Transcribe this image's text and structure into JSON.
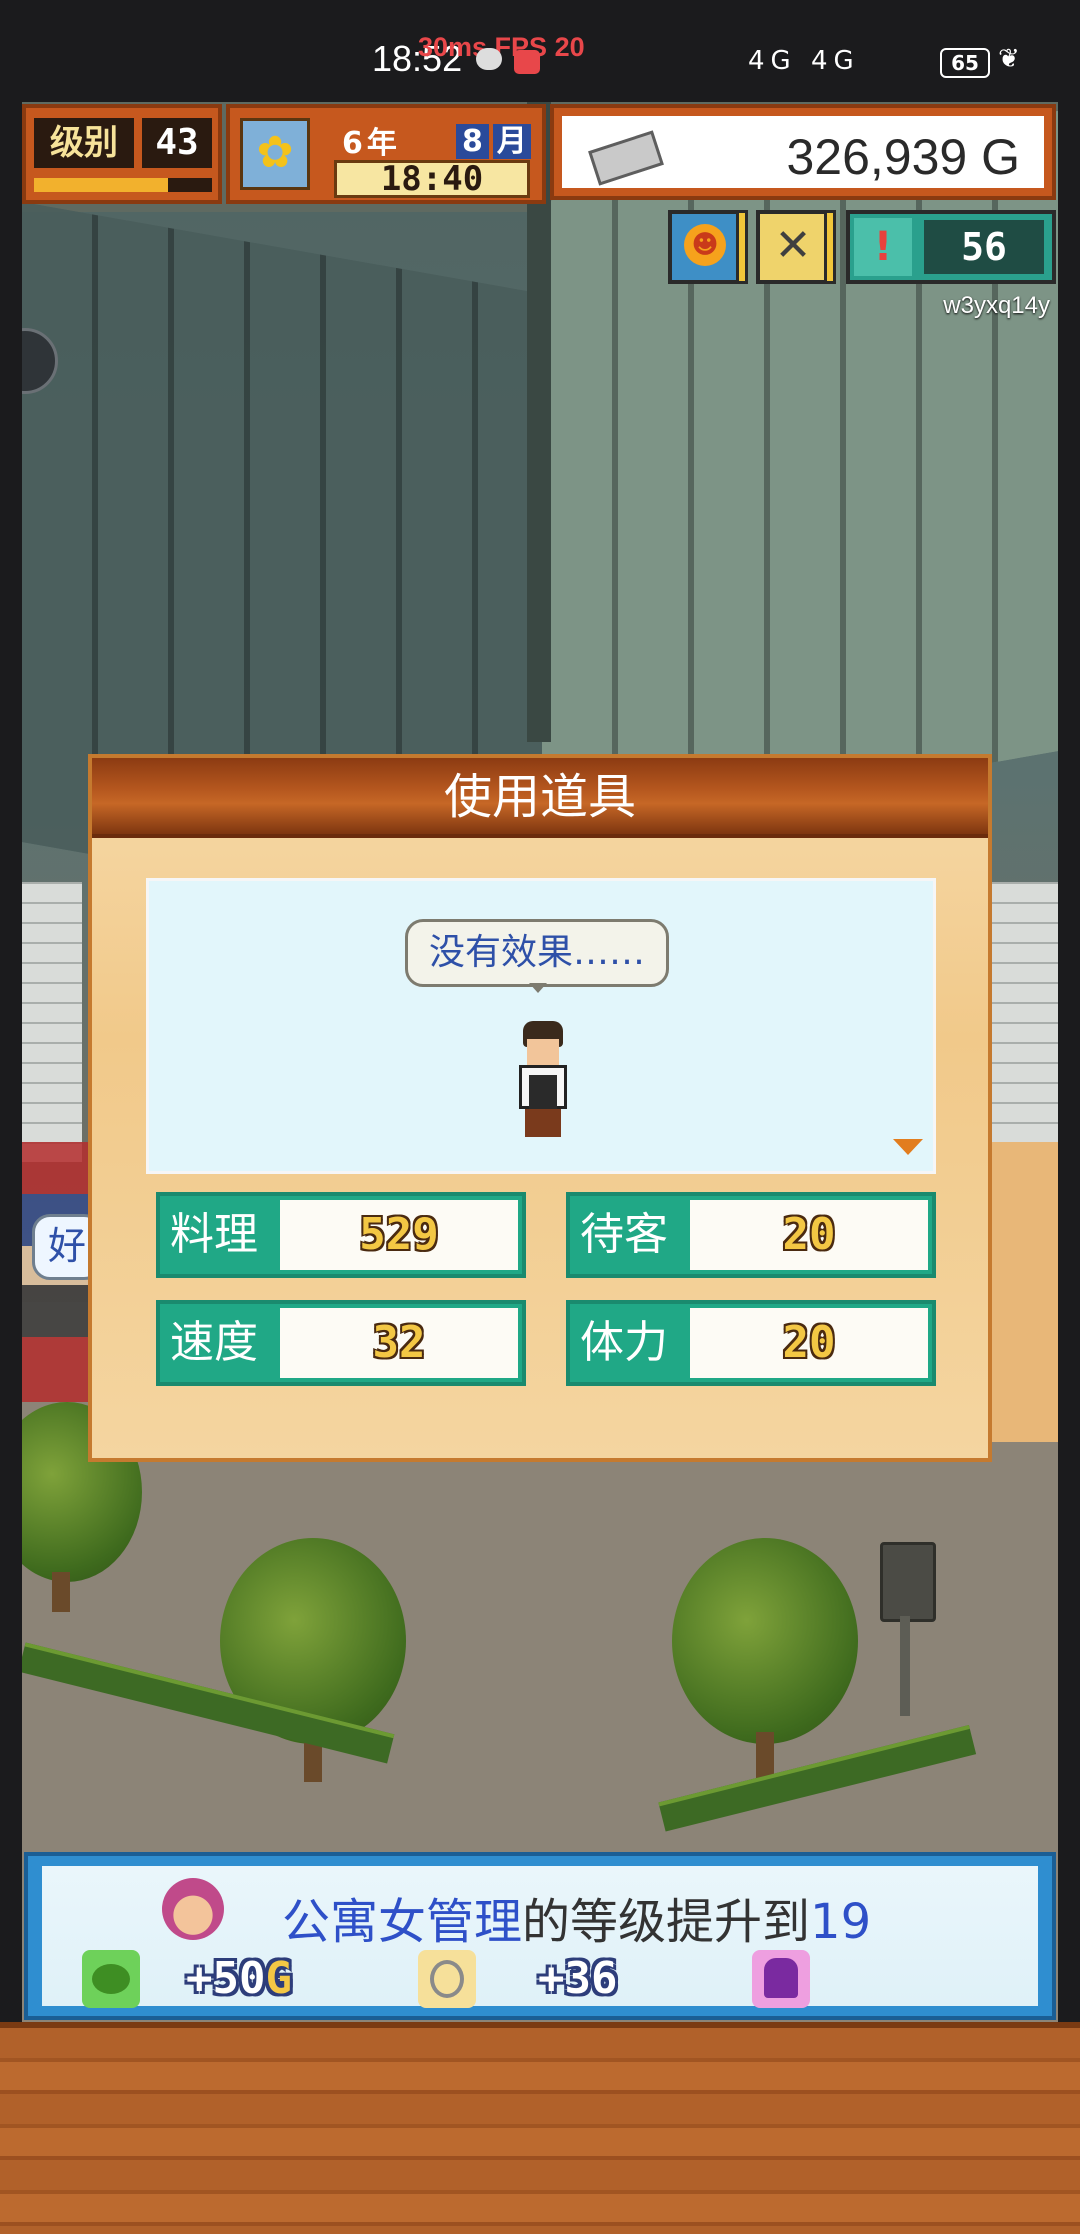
{
  "status_bar": {
    "time": "18:52",
    "perf": "30ms FPS 20",
    "network": "4G 4G",
    "battery": "65"
  },
  "hud": {
    "level_label": "级别",
    "level": "43",
    "level_progress": 0.75,
    "year": "6",
    "year_label": "年",
    "month": "8",
    "month_label": "月",
    "clock": "18:40",
    "money": "326,939 G",
    "alert_count": "56"
  },
  "username": "w3yxq14y",
  "side_bubble_text": "好",
  "dialog": {
    "title": "使用道具",
    "speech": "没有效果……",
    "stats": [
      {
        "label": "料理",
        "value": "529"
      },
      {
        "label": "待客",
        "value": "20"
      },
      {
        "label": "速度",
        "value": "32"
      },
      {
        "label": "体力",
        "value": "20"
      }
    ]
  },
  "notice": {
    "subject": "公寓女管理",
    "middle": "的等级提升到",
    "level": "19",
    "reward1": "+50",
    "reward1_unit": "G",
    "reward2": "+36"
  },
  "colors": {
    "hud_orange": "#c6581e",
    "stat_green": "#20a886",
    "notice_blue": "#2e50c8",
    "dialog_bg": "#f6d9a7"
  },
  "icons": {
    "sunflower": "sunflower-icon",
    "gold_bar": "gold-bar-icon",
    "mood": "mood-face-icon",
    "tools": "knife-fork-icon",
    "alert": "alert-icon",
    "next": "next-arrow-icon"
  }
}
